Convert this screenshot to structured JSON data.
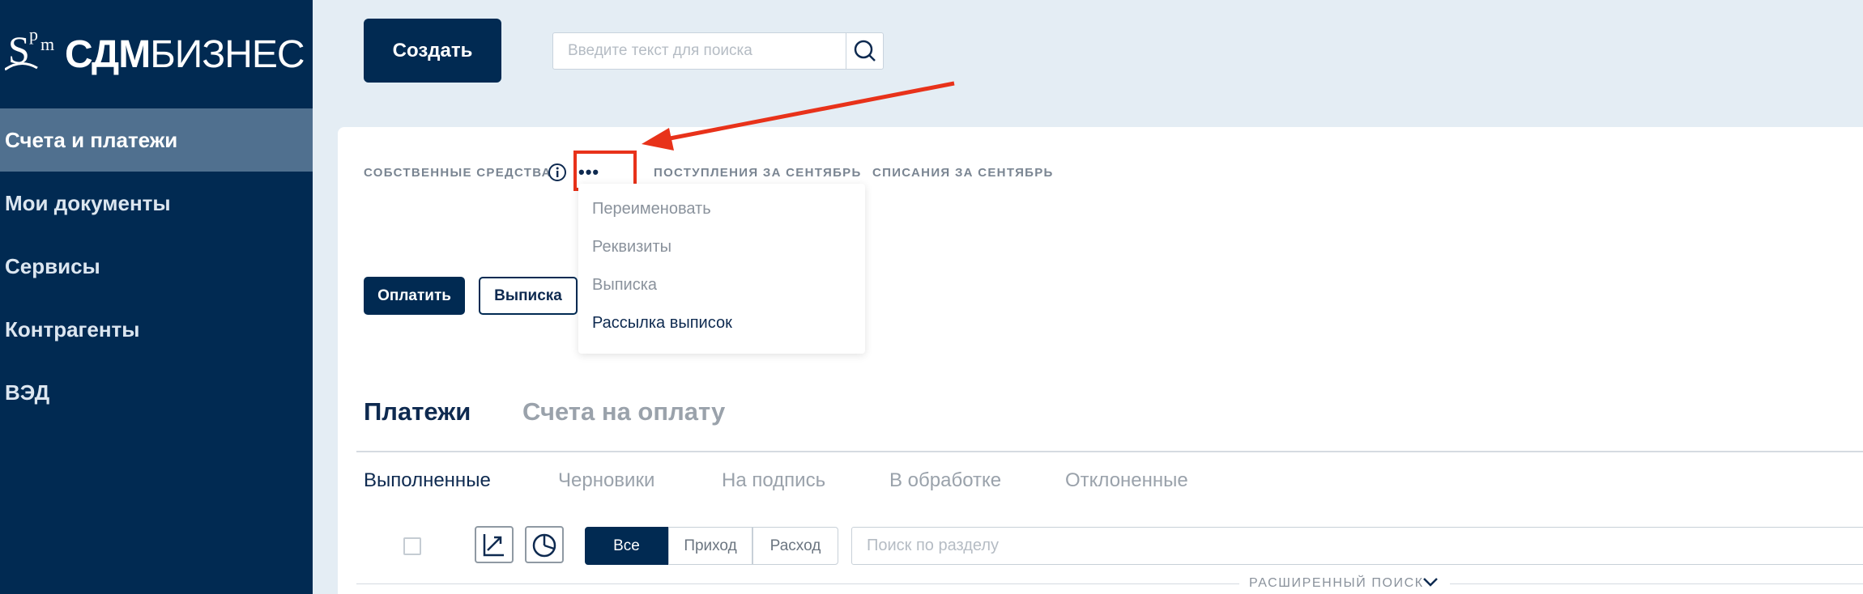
{
  "app": {
    "logo_mark": "Sp m",
    "logo_bold": "СДМ",
    "logo_light": "БИЗНЕС"
  },
  "sidebar": {
    "items": [
      {
        "label": "Счета и платежи",
        "active": true
      },
      {
        "label": "Мои документы",
        "active": false
      },
      {
        "label": "Сервисы",
        "active": false
      },
      {
        "label": "Контрагенты",
        "active": false
      },
      {
        "label": "ВЭД",
        "active": false
      }
    ]
  },
  "header": {
    "create_label": "Создать",
    "search_placeholder": "Введите текст для поиска",
    "search_icon": "magnifier-icon"
  },
  "stats": {
    "own_funds": "СОБСТВЕННЫЕ СРЕДСТВА",
    "more": "•••",
    "income": "ПОСТУПЛЕНИЯ ЗА СЕНТЯБРЬ",
    "expense": "СПИСАНИЯ ЗА СЕНТЯБРЬ"
  },
  "dropdown": {
    "items": [
      "Переименовать",
      "Реквизиты",
      "Выписка",
      "Рассылка выписок"
    ]
  },
  "actions": {
    "pay": "Оплатить",
    "statement": "Выписка"
  },
  "tabs": {
    "main": [
      "Платежи",
      "Счета на оплату"
    ],
    "sub": [
      "Выполненные",
      "Черновики",
      "На подпись",
      "В обработке",
      "Отклоненные"
    ]
  },
  "filters": {
    "segments": [
      "Все",
      "Приход",
      "Расход"
    ],
    "section_search_placeholder": "Поиск по разделу",
    "advanced_search": "РАСШИРЕННЫЙ ПОИСК"
  },
  "colors": {
    "brand_dark": "#012a52",
    "sidebar_active": "#50708f",
    "highlight": "#e8321a",
    "background": "#e4edf4"
  }
}
